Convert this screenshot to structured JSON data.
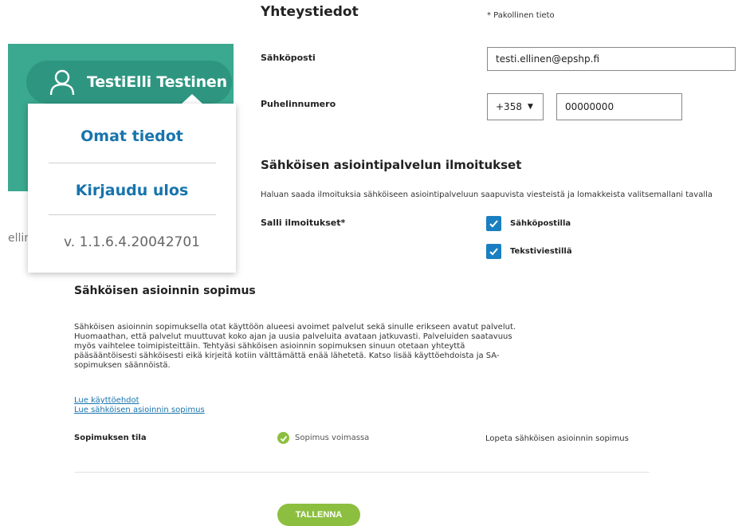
{
  "user_menu": {
    "user_name": "TestiElli Testinen",
    "items": [
      "Omat tiedot",
      "Kirjaudu ulos"
    ],
    "version": "v. 1.1.6.4.20042701",
    "background_partial_text": "ellin"
  },
  "contact": {
    "title": "Yhteystiedot",
    "required_note": "* Pakollinen tieto",
    "email_label": "Sähköposti",
    "email_value": "testi.ellinen@epshp.fi",
    "phone_label": "Puhelinnumero",
    "country_code": "+358",
    "phone_value": "00000000"
  },
  "notifications": {
    "title": "Sähköisen asiointipalvelun ilmoitukset",
    "description": "Haluan saada ilmoituksia sähköiseen asiointipalveluun saapuvista viesteistä ja lomakkeista valitsemallani tavalla",
    "allow_label": "Salli ilmoitukset*",
    "options": [
      {
        "label": "Sähköpostilla",
        "checked": true
      },
      {
        "label": "Tekstiviestillä",
        "checked": true
      }
    ]
  },
  "agreement": {
    "title": "Sähköisen asioinnin sopimus",
    "paragraph_lines": [
      "Sähköisen asioinnin sopimuksella otat käyttöön alueesi avoimet palvelut sekä sinulle erikseen avatut palvelut.",
      "Huomaathan, että palvelut muuttuvat koko ajan ja uusia palveluita avataan jatkuvasti. Palveluiden saatavuus",
      "myös vaihtelee toimipisteittäin. Tehtyäsi sähköisen asioinnin sopimuksen sinuun otetaan yhteyttä",
      "pääsääntöisesti sähköisesti eikä kirjeitä kotiin välttämättä enää lähetetä. Katso lisää käyttöehdoista ja SA-",
      "sopimuksen säännöistä."
    ],
    "link_terms": "Lue käyttöehdot",
    "link_agreement": "Lue sähköisen asioinnin sopimus",
    "status_label": "Sopimuksen tila",
    "status_value": "Sopimus voimassa",
    "cancel_link": "Lopeta sähköisen asioinnin sopimus"
  },
  "actions": {
    "save_label": "TALLENNA"
  },
  "colors": {
    "teal": "#3aa98f",
    "accent_blue": "#1774ad",
    "check_blue": "#1a7fc1",
    "green": "#8cbf3f"
  }
}
